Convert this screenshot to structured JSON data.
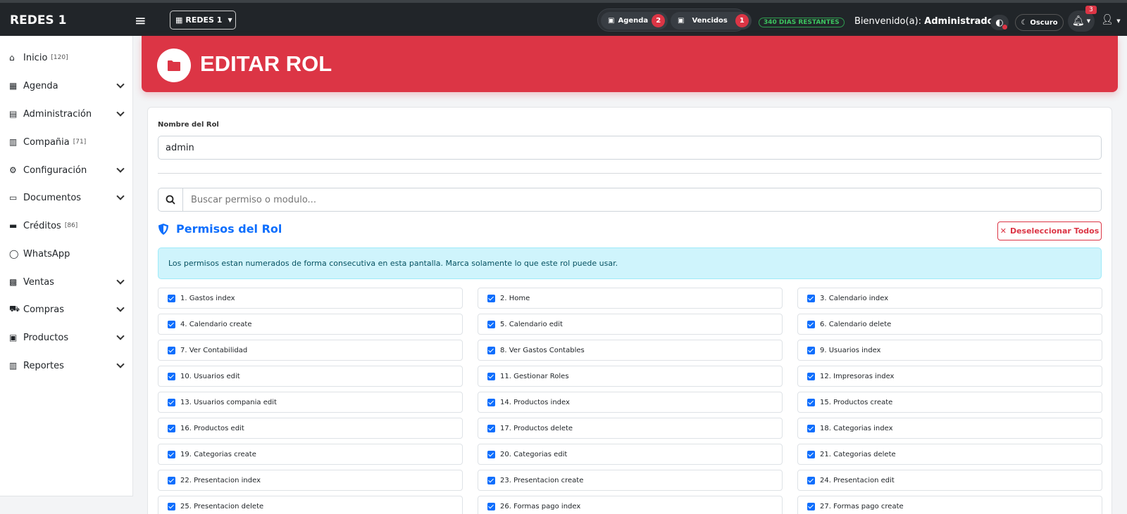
{
  "topbar": {
    "brand": "REDES 1",
    "company_selector": "REDES 1",
    "agenda_label": "Agenda",
    "agenda_count": "2",
    "vencidos_label": "Vencidos",
    "vencidos_count": "1",
    "days_remaining": "340 DIAS RESTANTES",
    "welcome_prefix": "Bienvenido(a):",
    "welcome_user": "Administrador",
    "dark_mode_label": "Oscuro",
    "notification_count": "3"
  },
  "sidebar": {
    "items": [
      {
        "label": "Inicio",
        "count": "[120]",
        "icon": "home-icon",
        "expandable": false
      },
      {
        "label": "Agenda",
        "count": "",
        "icon": "calendar-icon",
        "expandable": true
      },
      {
        "label": "Administración",
        "count": "",
        "icon": "id-card-icon",
        "expandable": true
      },
      {
        "label": "Compañia",
        "count": "[71]",
        "icon": "building-icon",
        "expandable": false
      },
      {
        "label": "Configuración",
        "count": "",
        "icon": "gears-icon",
        "expandable": true
      },
      {
        "label": "Documentos",
        "count": "",
        "icon": "folder-open-icon",
        "expandable": true
      },
      {
        "label": "Créditos",
        "count": "[86]",
        "icon": "credit-card-icon",
        "expandable": false
      },
      {
        "label": "WhatsApp",
        "count": "",
        "icon": "whatsapp-icon",
        "expandable": false
      },
      {
        "label": "Ventas",
        "count": "",
        "icon": "cash-register-icon",
        "expandable": true
      },
      {
        "label": "Compras",
        "count": "",
        "icon": "cart-icon",
        "expandable": true
      },
      {
        "label": "Productos",
        "count": "",
        "icon": "boxes-icon",
        "expandable": true
      },
      {
        "label": "Reportes",
        "count": "",
        "icon": "chart-icon",
        "expandable": true
      }
    ]
  },
  "header": {
    "title": "EDITAR ROL",
    "icon": "folder-icon"
  },
  "form": {
    "name_label": "Nombre del Rol",
    "name_value": "admin",
    "search_placeholder": "Buscar permiso o modulo...",
    "permissions_title": "Permisos del Rol",
    "deselect_all_label": "Deseleccionar Todos",
    "info_text": "Los permisos estan numerados de forma consecutiva en esta pantalla. Marca solamente lo que este rol puede usar.",
    "permissions": [
      "1. Gastos index",
      "2. Home",
      "3. Calendario index",
      "4. Calendario create",
      "5. Calendario edit",
      "6. Calendario delete",
      "7. Ver Contabilidad",
      "8. Ver Gastos Contables",
      "9. Usuarios index",
      "10. Usuarios edit",
      "11. Gestionar Roles",
      "12. Impresoras index",
      "13. Usuarios compania edit",
      "14. Productos index",
      "15. Productos create",
      "16. Productos edit",
      "17. Productos delete",
      "18. Categorias index",
      "19. Categorias create",
      "20. Categorias edit",
      "21. Categorias delete",
      "22. Presentacion index",
      "23. Presentacion create",
      "24. Presentacion edit",
      "25. Presentacion delete",
      "26. Formas pago index",
      "27. Formas pago create"
    ]
  },
  "colors": {
    "topbar": "#212529",
    "accent_red": "#dc3545",
    "primary_blue": "#0d6efd",
    "info_bg": "#cff4fc"
  }
}
